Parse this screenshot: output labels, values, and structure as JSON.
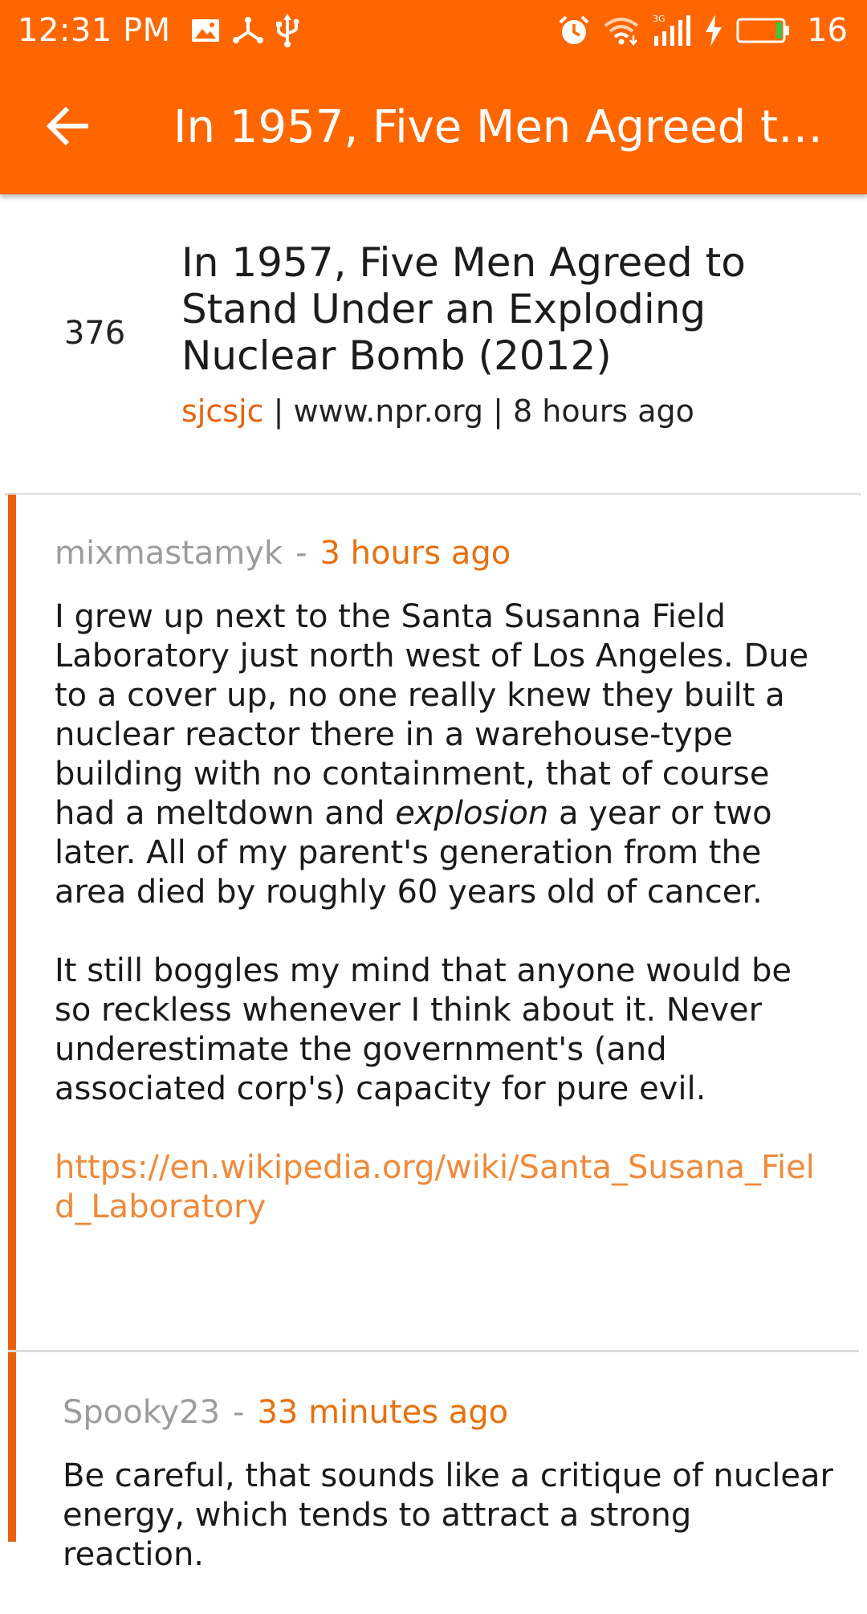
{
  "status_bar": {
    "time": "12:31 PM",
    "network_label": "3G",
    "battery_level": "16",
    "icons": [
      "image-icon",
      "share-icon",
      "usb-icon",
      "alarm-icon",
      "wifi-icon",
      "signal-icon",
      "charging-icon",
      "battery-icon"
    ]
  },
  "app_bar": {
    "title": "In 1957, Five Men Agreed to Stand Under an Exploding Nuclear Bomb (2012)",
    "back_icon": "arrow-back-icon"
  },
  "story": {
    "score": "376",
    "title": "In 1957, Five Men Agreed to Stand Under an Exploding Nuclear Bomb (2012)",
    "author": "sjcsjc",
    "separator": " | ",
    "domain": "www.npr.org",
    "time": "8 hours ago"
  },
  "comments": [
    {
      "author": "mixmastamyk",
      "separator": "-",
      "time": "3 hours ago",
      "para1_part1": "I grew up next to the Santa Susanna Field Laboratory just north west of Los Angeles. Due to a cover up, no one really knew they built a nuclear reactor there in a warehouse-type building with no containment, that of course had a meltdown and ",
      "para1_emphasis": "explosion",
      "para1_part2": " a year or two later. All of my parent's generation from the area died by roughly 60 years old of cancer.",
      "para2": "It still boggles my mind that anyone would be so reckless whenever I think about it. Never underestimate the government's (and associated corp's) capacity for pure evil.",
      "link": "https://en.wikipedia.org/wiki/Santa_Susana_Field_Laboratory"
    },
    {
      "author": "Spooky23",
      "separator": "-",
      "time": "33 minutes ago",
      "text": "Be careful, that sounds like a critique of nuclear energy, which tends to attract a strong reaction."
    }
  ],
  "colors": {
    "primary": "#ff6600",
    "accent": "#e8620e",
    "link": "#f08a3a",
    "meta_gray": "#9c9c9c",
    "divider": "#dcdcdc"
  }
}
